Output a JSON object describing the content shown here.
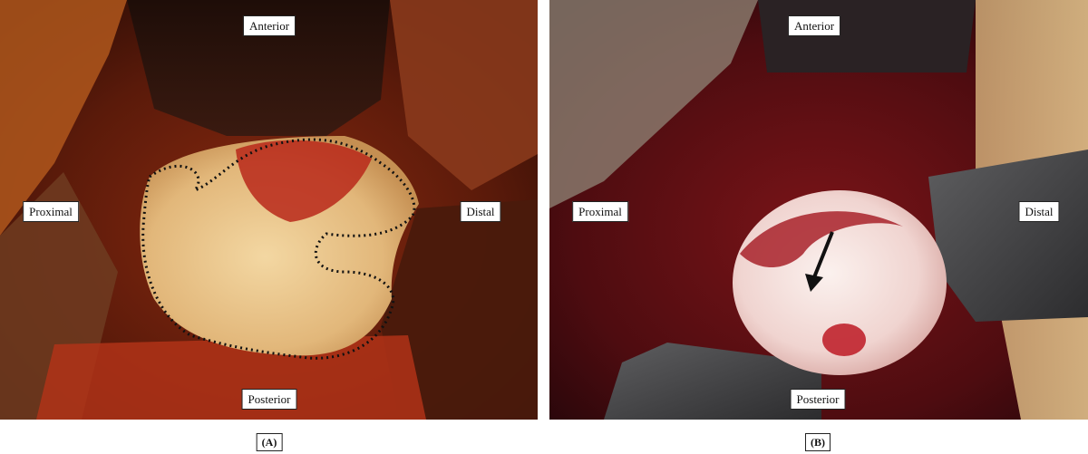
{
  "panel_a": {
    "labels": {
      "anterior": "Anterior",
      "proximal": "Proximal",
      "distal": "Distal",
      "posterior": "Posterior"
    },
    "caption": "(A)"
  },
  "panel_b": {
    "labels": {
      "anterior": "Anterior",
      "proximal": "Proximal",
      "distal": "Distal",
      "posterior": "Posterior"
    },
    "caption": "(B)"
  }
}
